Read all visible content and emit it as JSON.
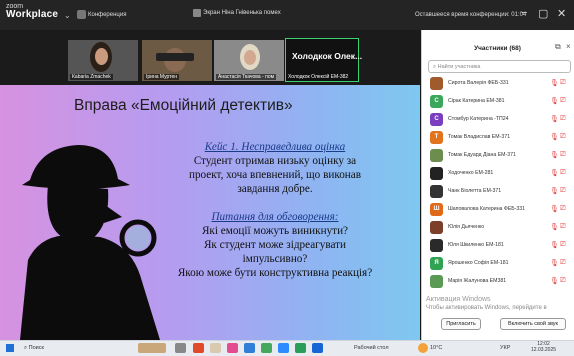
{
  "titlebar": {
    "brand_top": "zoom",
    "brand_main": "Workplace",
    "conference_label": "Конференция",
    "screen_share_label": "Экран Ніна Гнівенька помех",
    "remaining_time": "Оставшееся время конференции: 01:04"
  },
  "videos": [
    {
      "name": "Кabaria Zmachek"
    },
    {
      "name": "Ірина Муртен"
    },
    {
      "name": "Анастасія Ткачова - пом"
    },
    {
      "name": "Холодкок Олексій ЕМ-382"
    }
  ],
  "active_speaker": {
    "big_name": "Холодкок Олек..."
  },
  "slide": {
    "title": "Вправа «Емоційний детектив»",
    "case_title": "Кейс 1. Несправедлива оцінка",
    "case_lines": [
      "Студент отримав низьку оцінку за",
      "проект, хоча впевнений, що виконав",
      "завдання добре."
    ],
    "q_title": "Питання для обговорення:",
    "q_lines": [
      "Які емоції можуть виникнути?",
      "Як студент може зідреагувати",
      "імпульсивно?",
      "Якою може бути конструктивна реакція?"
    ]
  },
  "participants": {
    "title": "Участники (68)",
    "search_placeholder": "Найти участника",
    "list": [
      {
        "initial": "",
        "name": "Сирота Валерія ФЕБ-331",
        "color": "#a05a2c"
      },
      {
        "initial": "С",
        "name": "Сірак Катерина ЕМ-381",
        "color": "#3aa75a"
      },
      {
        "initial": "С",
        "name": "Стомбур Катерина -ТП24",
        "color": "#7a3fbf"
      },
      {
        "initial": "Т",
        "name": "Томак Владислав ЕМ-371",
        "color": "#e2741d"
      },
      {
        "initial": "",
        "name": "Томак Едуард Діана ЕМ-371",
        "color": "#6b8e4e"
      },
      {
        "initial": "",
        "name": "Ходоченко ЕМ-281",
        "color": "#222222"
      },
      {
        "initial": "",
        "name": "Чанк Біолетта ЕМ-371",
        "color": "#333333"
      },
      {
        "initial": "Ш",
        "name": "Шаповалова Катерина ФЕБ-331",
        "color": "#e06a1a"
      },
      {
        "initial": "",
        "name": "Юлія Дьяченко",
        "color": "#7b3f2a"
      },
      {
        "initial": "",
        "name": "Юля Шкиленко ЕМ-181",
        "color": "#2a2a2a"
      },
      {
        "initial": "Я",
        "name": "Ярошенко Софія ЕМ-181",
        "color": "#2fa351"
      },
      {
        "initial": "",
        "name": "Марія Жалунова ЕМ381",
        "color": "#5b9a55"
      }
    ],
    "watermark_line1": "Активация Windows",
    "watermark_line2": "Чтобы активировать Windows, перейдите в",
    "invite_label": "Пригласить",
    "unmute_label": "Включить свой звук"
  },
  "taskbar": {
    "search_label": "Поиск",
    "work_label": "Рабочий стол",
    "temp": "10°C",
    "lang": "УКР",
    "time": "12:02",
    "date": "12.03.2025"
  }
}
